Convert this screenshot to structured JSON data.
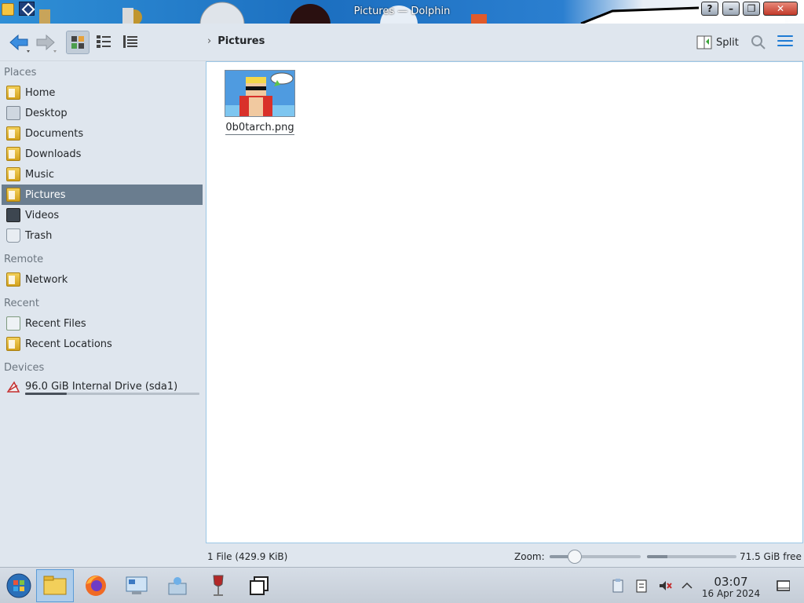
{
  "window": {
    "title": "Pictures — Dolphin"
  },
  "toolbar": {
    "back_icon": "arrow-left-icon",
    "forward_icon": "arrow-right-icon",
    "view_modes": [
      "icons-view",
      "compact-view",
      "details-view"
    ],
    "active_view": "icons-view",
    "breadcrumb": [
      "Pictures"
    ],
    "split_label": "Split",
    "accent": "#1d7ad4"
  },
  "sidebar": {
    "sections": [
      {
        "title": "Places",
        "items": [
          {
            "label": "Home",
            "icon": "home-folder-icon"
          },
          {
            "label": "Desktop",
            "icon": "desktop-folder-icon"
          },
          {
            "label": "Documents",
            "icon": "documents-folder-icon"
          },
          {
            "label": "Downloads",
            "icon": "downloads-folder-icon"
          },
          {
            "label": "Music",
            "icon": "music-folder-icon"
          },
          {
            "label": "Pictures",
            "icon": "pictures-folder-icon",
            "selected": true
          },
          {
            "label": "Videos",
            "icon": "videos-folder-icon"
          },
          {
            "label": "Trash",
            "icon": "trash-icon"
          }
        ]
      },
      {
        "title": "Remote",
        "items": [
          {
            "label": "Network",
            "icon": "network-folder-icon"
          }
        ]
      },
      {
        "title": "Recent",
        "items": [
          {
            "label": "Recent Files",
            "icon": "recent-files-icon"
          },
          {
            "label": "Recent Locations",
            "icon": "recent-locations-icon"
          }
        ]
      },
      {
        "title": "Devices",
        "items": [
          {
            "label": "96.0 GiB Internal Drive (sda1)",
            "icon": "hard-drive-icon",
            "usage_fraction": 0.24
          }
        ]
      }
    ],
    "selected_color": "#6a7d8f"
  },
  "content": {
    "files": [
      {
        "name": "0b0tarch.png",
        "icon": "image-thumbnail"
      }
    ]
  },
  "statusbar": {
    "summary": "1 File (429.9 KiB)",
    "zoom_label": "Zoom:",
    "zoom_fraction": 0.28,
    "free_space": "71.5 GiB free",
    "used_fraction": 0.23
  },
  "taskbar": {
    "apps": [
      {
        "name": "start-menu-icon",
        "active": false
      },
      {
        "name": "file-manager-icon",
        "active": true
      },
      {
        "name": "firefox-icon",
        "active": false
      },
      {
        "name": "system-settings-icon",
        "active": false
      },
      {
        "name": "software-center-icon",
        "active": false
      },
      {
        "name": "wine-icon",
        "active": false
      },
      {
        "name": "window-switcher-icon",
        "active": false
      }
    ],
    "tray": [
      "clipboard-icon",
      "notes-icon",
      "volume-muted-icon",
      "chevron-up-icon"
    ],
    "clock": {
      "time": "03:07",
      "date": "16 Apr 2024"
    },
    "show_desktop_icon": "show-desktop-icon"
  }
}
